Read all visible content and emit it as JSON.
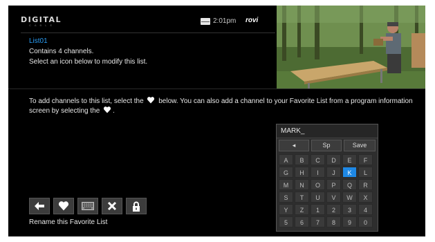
{
  "header": {
    "logo_line1": "DIGITAL",
    "logo_line2": "CABLE",
    "time": "2:01pm",
    "brand": "rovi"
  },
  "list": {
    "name": "List01",
    "channel_count_text": "Contains 4 channels.",
    "hint": "Select an icon below to modify this list."
  },
  "instructions": {
    "part1": "To add channels to this list, select the",
    "part2": "below. You can also add a channel to your Favorite List from a program information screen by selecting the",
    "part3": "."
  },
  "keyboard": {
    "input_value": "MARK_",
    "functions": [
      "◂",
      "Sp",
      "Save"
    ],
    "keys": [
      [
        "A",
        "B",
        "C",
        "D",
        "E",
        "F"
      ],
      [
        "G",
        "H",
        "I",
        "J",
        "K",
        "L"
      ],
      [
        "M",
        "N",
        "O",
        "P",
        "Q",
        "R"
      ],
      [
        "S",
        "T",
        "U",
        "V",
        "W",
        "X"
      ],
      [
        "Y",
        "Z",
        "1",
        "2",
        "3",
        "4"
      ],
      [
        "5",
        "6",
        "7",
        "8",
        "9",
        "0"
      ]
    ],
    "selected_key": "K",
    "selected_color": "#1e88e5"
  },
  "toolbar": {
    "icons": [
      "back-arrow-icon",
      "heart-icon",
      "keyboard-icon",
      "close-icon",
      "lock-icon"
    ],
    "caption": "Rename this Favorite List"
  },
  "colors": {
    "accent": "#2a9df4",
    "background": "#000000"
  }
}
